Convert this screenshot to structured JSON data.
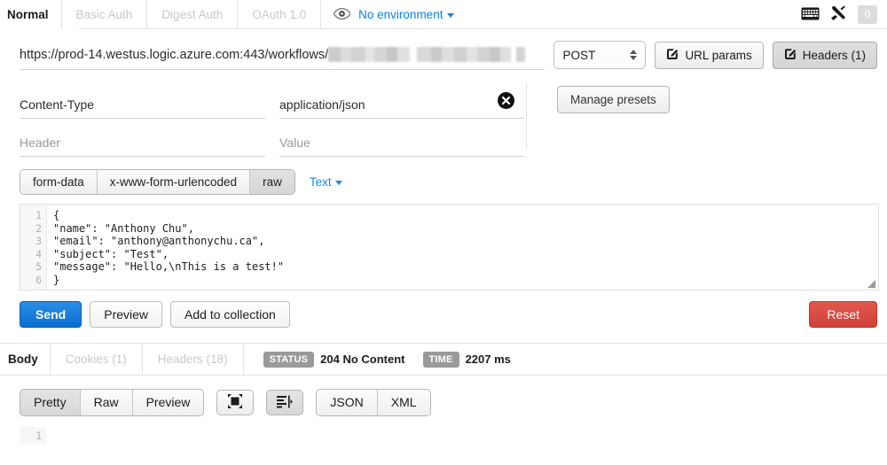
{
  "topbar": {
    "tabs": [
      {
        "label": "Normal",
        "active": true
      },
      {
        "label": "Basic Auth",
        "active": false
      },
      {
        "label": "Digest Auth",
        "active": false
      },
      {
        "label": "OAuth 1.0",
        "active": false
      }
    ],
    "eye_icon": "eye-icon",
    "environment": "No environment",
    "keyboard_icon": "keyboard-icon",
    "tools_icon": "wrench-screwdriver-icon",
    "badge_count": "0"
  },
  "request": {
    "url_text": "https://prod-14.westus.logic.azure.com:443/workflows/",
    "url_redacted": true,
    "method": "POST",
    "url_params_label": "URL params",
    "headers_label": "Headers (1)",
    "edit_icon": "pencil-square-icon"
  },
  "headers": {
    "rows": [
      {
        "key": "Content-Type",
        "value": "application/json",
        "deletable": true
      },
      {
        "key": "",
        "value": "",
        "key_placeholder": "Header",
        "value_placeholder": "Value",
        "deletable": false
      }
    ],
    "delete_icon": "close-circle-icon",
    "manage_presets_label": "Manage presets"
  },
  "body": {
    "types": [
      {
        "label": "form-data",
        "active": false
      },
      {
        "label": "x-www-form-urlencoded",
        "active": false
      },
      {
        "label": "raw",
        "active": true
      }
    ],
    "format_label": "Text",
    "line_numbers": [
      "1",
      "2",
      "3",
      "4",
      "5",
      "6"
    ],
    "code": "{\n\"name\": \"Anthony Chu\",\n\"email\": \"anthony@anthonychu.ca\",\n\"subject\": \"Test\",\n\"message\": \"Hello,\\nThis is a test!\"\n}"
  },
  "actions": {
    "send_label": "Send",
    "preview_label": "Preview",
    "add_to_collection_label": "Add to collection",
    "reset_label": "Reset"
  },
  "response": {
    "tabs": [
      {
        "label": "Body",
        "active": true
      },
      {
        "label": "Cookies (1)",
        "active": false
      },
      {
        "label": "Headers (18)",
        "active": false
      }
    ],
    "status_pill": "STATUS",
    "status_value": "204 No Content",
    "time_pill": "TIME",
    "time_value": "2207 ms",
    "view_modes": [
      {
        "label": "Pretty",
        "active": true
      },
      {
        "label": "Raw",
        "active": false
      },
      {
        "label": "Preview",
        "active": false
      }
    ],
    "fullscreen_icon": "fullscreen-icon",
    "wrap_icon": "word-wrap-icon",
    "formats": [
      {
        "label": "JSON",
        "active": false
      },
      {
        "label": "XML",
        "active": false
      }
    ],
    "line_numbers": [
      "1"
    ]
  },
  "colors": {
    "accent_blue": "#0c7ff2",
    "send_blue": "#0a6ed1",
    "reset_red": "#cf4138",
    "muted_gray": "#c9c9c9",
    "pill_gray": "#9a9a9a"
  }
}
